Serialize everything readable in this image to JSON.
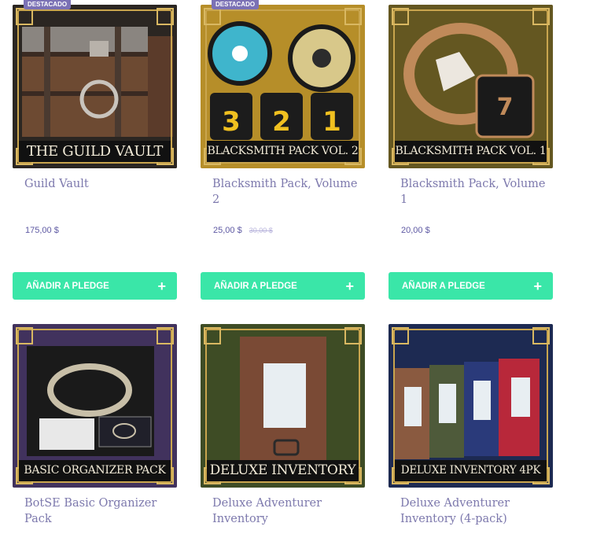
{
  "products": [
    {
      "title": "Guild Vault",
      "banner": "THE GUILD VAULT",
      "price": "175,00 $",
      "old_price": "",
      "badge": "DESTACADO",
      "button": "AÑADIR A PLEDGE",
      "plus": "+",
      "icon": "treasure-chest-image"
    },
    {
      "title": "Blacksmith Pack, Volume 2",
      "banner": "BLACKSMITH PACK VOL. 2",
      "price": "25,00 $",
      "old_price": "30,00 $",
      "badge": "DESTACADO",
      "button": "AÑADIR A PLEDGE",
      "plus": "+",
      "icon": "dice-wheels-image"
    },
    {
      "title": "Blacksmith Pack, Volume 1",
      "banner": "BLACKSMITH PACK VOL. 1",
      "price": "20,00 $",
      "old_price": "",
      "badge": "",
      "button": "AÑADIR A PLEDGE",
      "plus": "+",
      "icon": "ring-dice-image"
    },
    {
      "title": "BotSE Basic Organizer Pack",
      "banner": "BASIC ORGANIZER PACK",
      "price": "",
      "old_price": "",
      "badge": "",
      "button": "",
      "plus": "",
      "icon": "organizer-box-image"
    },
    {
      "title": "Deluxe Adventurer Inventory",
      "banner": "DELUXE INVENTORY",
      "price": "",
      "old_price": "",
      "badge": "",
      "button": "",
      "plus": "",
      "icon": "inventory-folder-image"
    },
    {
      "title": "Deluxe Adventurer Inventory (4-pack)",
      "banner": "DELUXE INVENTORY 4PK",
      "price": "",
      "old_price": "",
      "badge": "",
      "button": "",
      "plus": "",
      "icon": "inventory-4pack-image"
    }
  ],
  "colors": {
    "button": "#3ae6a8",
    "title": "#7d79ad",
    "price": "#5e59a3",
    "badge": "#7b71b5",
    "frame_gold": "#c9a54e"
  }
}
